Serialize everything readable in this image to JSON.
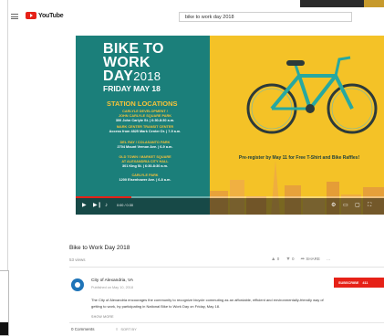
{
  "header": {
    "logo_text": "YouTube",
    "search_value": "bike to work day 2018"
  },
  "video": {
    "headline_line1": "BIKE TO",
    "headline_line2": "WORK",
    "headline_line3": "DAY",
    "headline_year": "2018",
    "headline_date": "FRIDAY MAY 18",
    "station_title": "STATION LOCATIONS",
    "stations": [
      {
        "name": "CARLYLE DEVELOPMENT /",
        "name2": "JOHN CARLYLE SQUARE PARK",
        "address": "300 John Carlyle St. | 6:30-8:30 a.m."
      },
      {
        "name": "MARK CENTER TRANSIT CENTER",
        "name2": "",
        "address": "Access from 4825 Mark Center Dr. | 7-9 a.m."
      },
      {
        "name": "DEL RAY / COLASANTO PARK",
        "name2": "",
        "address": "2704 Mount Vernon Ave. | 6-9 a.m."
      },
      {
        "name": "OLD TOWN / MARKET SQUARE",
        "name2": "AT ALEXANDRIA CITY HALL",
        "address": "301 King St. | 6:30-8:30 a.m."
      },
      {
        "name": "CARLYLE PARK",
        "name2": "",
        "address": "1200 Eisenhower Ave. | 6-8 a.m."
      }
    ],
    "preregister": "Pre-register by May 11 for Free T-Shirt and Bike Raffles!",
    "time": "0:00 / 0:30",
    "progress": 0.18,
    "colors": {
      "teal": "#1b7f7a",
      "yellow": "#f4c227",
      "bike": "#27a8a0"
    }
  },
  "info": {
    "title": "Bike to Work Day 2018",
    "views": "53 views",
    "likes": "0",
    "dislikes": "0",
    "share_label": "SHARE",
    "more_label": "···"
  },
  "channel": {
    "name": "City of Alexandria, VA",
    "published": "Published on May 10, 2018",
    "subscribe_label": "SUBSCRIBE",
    "subscriber_count": "411",
    "description": "The City of Alexandria encourages the community to recognize bicycle commuting as an affordable, efficient and environmentally-friendly way of getting to work, by participating in National Bike to Work Day on Friday, May 18.",
    "show_more": "SHOW MORE"
  },
  "comments": {
    "count_label": "0 Comments",
    "sort_label": "SORT BY"
  }
}
